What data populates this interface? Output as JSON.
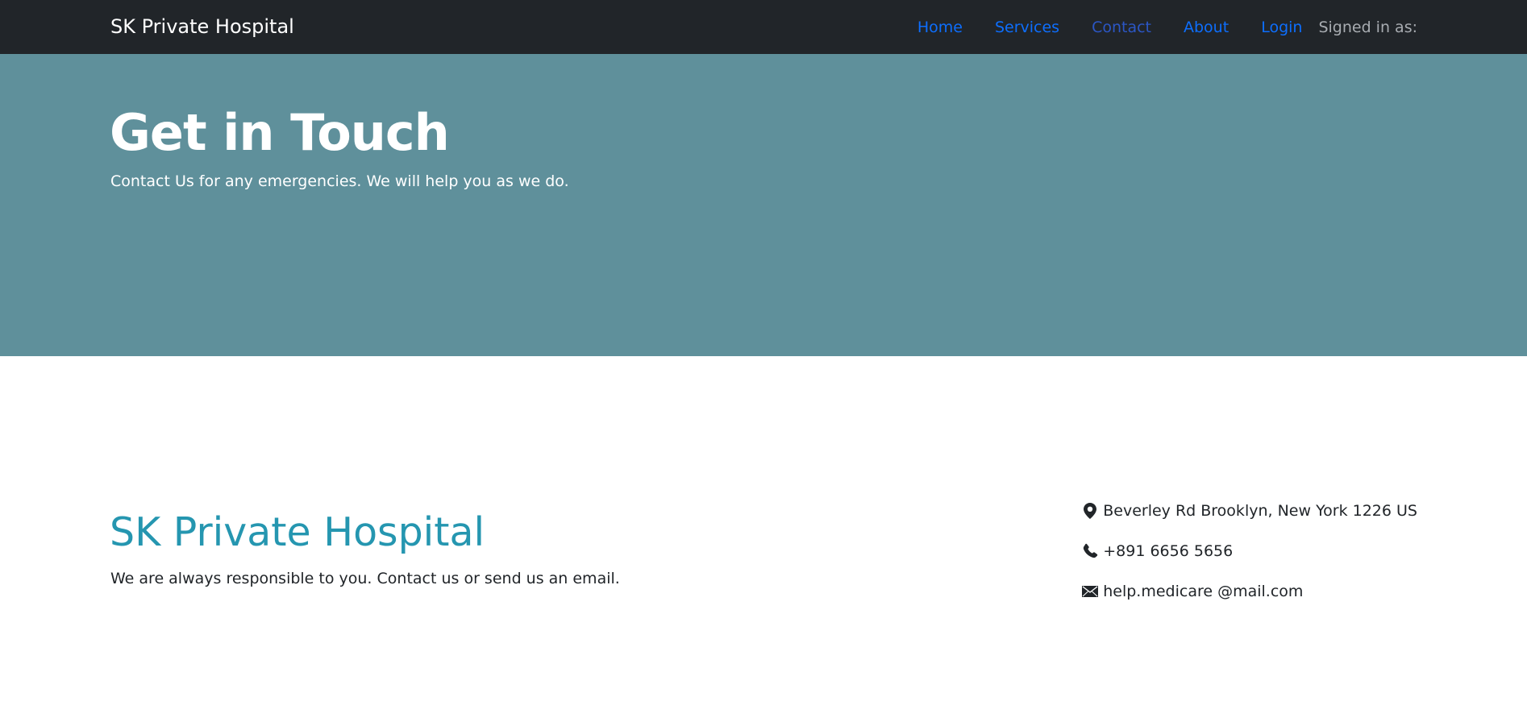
{
  "navbar": {
    "brand": "SK Private Hospital",
    "links": [
      {
        "label": "Home"
      },
      {
        "label": "Services"
      },
      {
        "label": "Contact"
      },
      {
        "label": "About"
      },
      {
        "label": "Login"
      }
    ],
    "signed_in_text": "Signed in as:",
    "colors": {
      "background": "#212529",
      "link": "#0d6efd"
    }
  },
  "hero": {
    "title": "Get in Touch",
    "subtitle": "Contact Us for any emergencies. We will help you as we do.",
    "background_color": "#5f909b"
  },
  "contact": {
    "title": "SK Private Hospital",
    "description": "We are always responsible to you. Contact us or send us an email.",
    "title_color": "#2596b0",
    "info": [
      {
        "icon": "location-pin-icon",
        "text": "Beverley Rd Brooklyn, New York 1226 US"
      },
      {
        "icon": "phone-icon",
        "text": "+891 6656 5656"
      },
      {
        "icon": "envelope-icon",
        "text": "help.medicare @mail.com"
      }
    ]
  }
}
